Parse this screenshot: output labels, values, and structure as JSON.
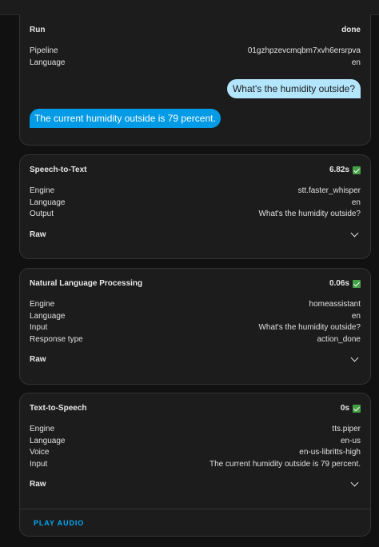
{
  "run": {
    "title": "Run",
    "status": "done",
    "rows": [
      {
        "label": "Pipeline",
        "value": "01gzhpzevcmqbm7xvh6ersrpva"
      },
      {
        "label": "Language",
        "value": "en"
      }
    ],
    "user_message": "What's the humidity outside?",
    "agent_message": "The current humidity outside is 79 percent."
  },
  "stt": {
    "title": "Speech-to-Text",
    "time": "6.82s",
    "rows": [
      {
        "label": "Engine",
        "value": "stt.faster_whisper"
      },
      {
        "label": "Language",
        "value": "en"
      },
      {
        "label": "Output",
        "value": "What's the humidity outside?"
      }
    ],
    "raw_label": "Raw"
  },
  "nlp": {
    "title": "Natural Language Processing",
    "time": "0.06s",
    "rows": [
      {
        "label": "Engine",
        "value": "homeassistant"
      },
      {
        "label": "Language",
        "value": "en"
      },
      {
        "label": "Input",
        "value": "What's the humidity outside?"
      },
      {
        "label": "Response type",
        "value": "action_done"
      }
    ],
    "raw_label": "Raw"
  },
  "tts": {
    "title": "Text-to-Speech",
    "time": "0s",
    "rows": [
      {
        "label": "Engine",
        "value": "tts.piper"
      },
      {
        "label": "Language",
        "value": "en-us"
      },
      {
        "label": "Voice",
        "value": "en-us-libritts-high"
      },
      {
        "label": "Input",
        "value": "The current humidity outside is 79 percent."
      }
    ],
    "raw_label": "Raw",
    "play_label": "PLAY AUDIO"
  },
  "icons": {
    "check": "check-icon",
    "expand": "chevron-down-icon"
  },
  "colors": {
    "success": "#43a047",
    "accent": "#03a9f4",
    "user_bubble": "#b3e5fc",
    "agent_bubble": "#039be5"
  }
}
